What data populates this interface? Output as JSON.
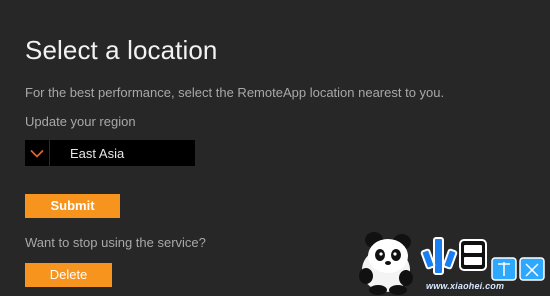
{
  "page": {
    "title": "Select a location",
    "description": "For the best performance, select the RemoteApp location nearest to you.",
    "region_label": "Update your region"
  },
  "region_select": {
    "selected_value": "East Asia",
    "arrow_icon": "chevron-down-icon"
  },
  "buttons": {
    "submit_label": "Submit",
    "delete_label": "Delete"
  },
  "stop_service_text": "Want to stop using the service?",
  "watermark": {
    "url": "www.xiaohei.com"
  },
  "colors": {
    "background": "#272727",
    "accent": "#f7941d",
    "select_background": "#000000",
    "select_arrow": "#e8672a"
  }
}
